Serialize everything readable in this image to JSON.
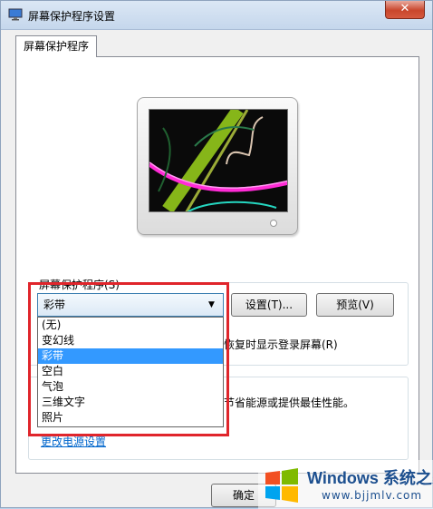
{
  "window": {
    "title": "屏幕保护程序设置",
    "close_glyph": "✕"
  },
  "tabs": [
    {
      "label": "屏幕保护程序"
    }
  ],
  "screensaver": {
    "group_label": "屏幕保护程序(S)",
    "selected": "彩带",
    "options": [
      "(无)",
      "变幻线",
      "彩带",
      "空白",
      "气泡",
      "三维文字",
      "照片"
    ],
    "settings_button": "设置(T)...",
    "preview_button": "预览(V)"
  },
  "resume": {
    "text": "恢复时显示登录屏幕(R)"
  },
  "power": {
    "desc_partial": "节省能源或提供最佳性能。",
    "link": "更改电源设置"
  },
  "footer": {
    "ok_button": "确定"
  },
  "watermark": {
    "title": "Windows 系统之家",
    "url": "www.bjjmlv.com"
  },
  "colors": {
    "accent": "#3399ff",
    "highlight_box": "#e0252b",
    "link": "#0066cc"
  }
}
